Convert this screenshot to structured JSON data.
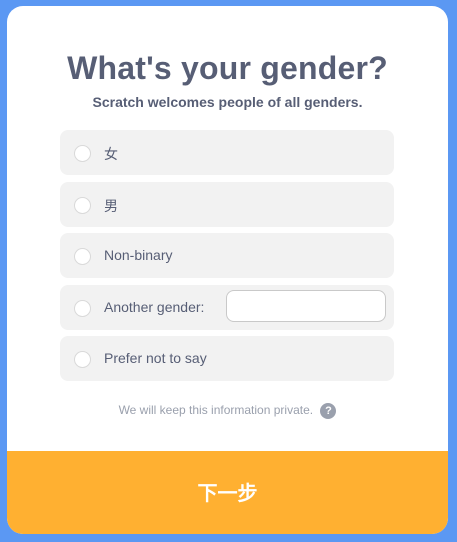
{
  "title": "What's your gender?",
  "subtitle": "Scratch welcomes people of all genders.",
  "options": [
    {
      "label": "女"
    },
    {
      "label": "男"
    },
    {
      "label": "Non-binary"
    },
    {
      "label": "Another gender:",
      "input_value": ""
    },
    {
      "label": "Prefer not to say"
    }
  ],
  "privacy_note": "We will keep this information private.",
  "help_icon": "?",
  "next_button": "下一步",
  "colors": {
    "background": "#5b98f3",
    "title": "#575e75",
    "option_bg": "#f2f2f2",
    "next_button": "#ffb031",
    "muted_text": "#9aa0ad"
  }
}
